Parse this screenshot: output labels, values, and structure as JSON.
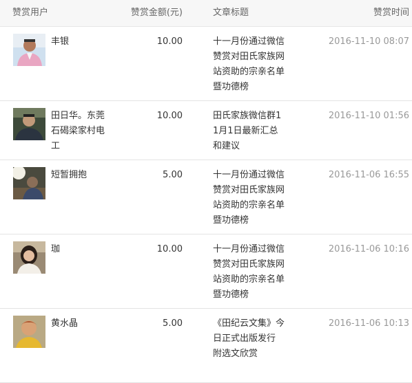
{
  "header": {
    "user": "赞赏用户",
    "amount": "赞赏金额(元)",
    "title": "文章标题",
    "time": "赞赏时间"
  },
  "rows": [
    {
      "name": "丰银",
      "amount": "10.00",
      "title": "十一月份通过微信赞赏对田氏家族网站资助的宗亲名单暨功德榜",
      "time": "2016-11-10 08:07",
      "avatar_icon": "avatar-photo",
      "avatar_bg": "#cfe0ef"
    },
    {
      "name": "田日华。东莞石碣梁家村电工",
      "amount": "10.00",
      "title": "田氏家族微信群11月1日最新汇总和建议",
      "time": "2016-11-10 01:56",
      "avatar_icon": "avatar-photo",
      "avatar_bg": "#3d4a3a"
    },
    {
      "name": "短暂拥抱",
      "amount": "5.00",
      "title": "十一月份通过微信赞赏对田氏家族网站资助的宗亲名单暨功德榜",
      "time": "2016-11-06 16:55",
      "avatar_icon": "avatar-photo",
      "avatar_bg": "#4a4a3e"
    },
    {
      "name": "珈",
      "amount": "10.00",
      "title": "十一月份通过微信赞赏对田氏家族网站资助的宗亲名单暨功德榜",
      "time": "2016-11-06 10:16",
      "avatar_icon": "avatar-photo",
      "avatar_bg": "#9a8a74"
    },
    {
      "name": "黄水晶",
      "amount": "5.00",
      "title": "《田纪云文集》今日正式出版发行 附选文欣赏",
      "time": "2016-11-06 10:13",
      "avatar_icon": "avatar-photo",
      "avatar_bg": "#b9a984"
    }
  ]
}
